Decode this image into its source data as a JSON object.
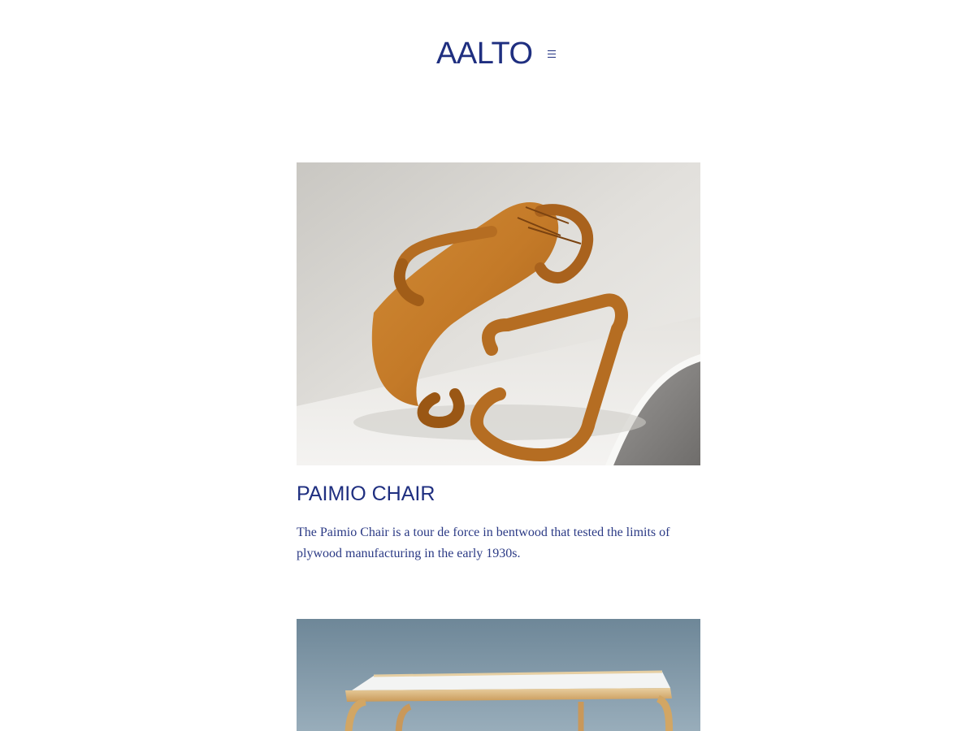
{
  "header": {
    "logo": "AALTO",
    "menu_icon": "hamburger-menu-icon"
  },
  "products": [
    {
      "title": "PAIMIO CHAIR",
      "description": "The Paimio Chair is a tour de force in bentwood that tested the limits of plywood manufacturing in the early 1930s.",
      "image_icon": "paimio-chair-photo"
    },
    {
      "image_icon": "tea-trolley-table-photo"
    }
  ],
  "colors": {
    "brand": "#1f2f80",
    "background": "#ffffff"
  }
}
